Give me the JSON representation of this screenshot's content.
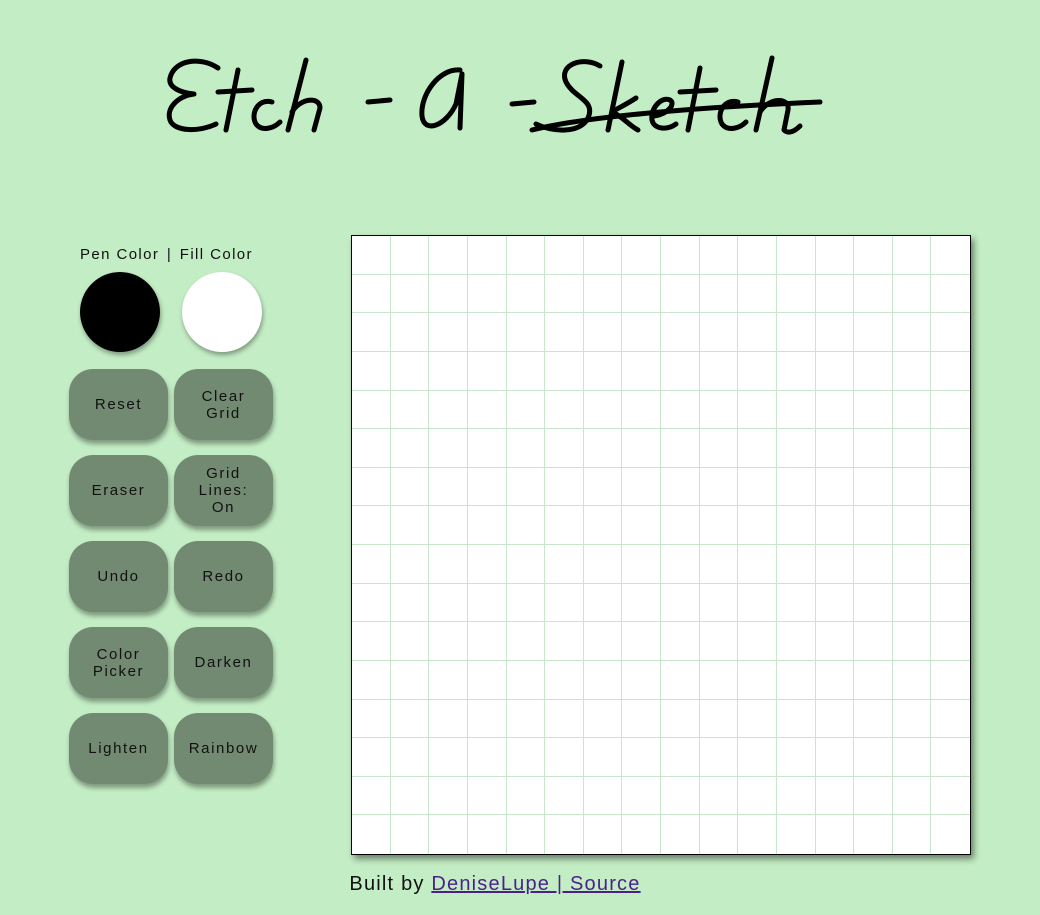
{
  "header": {
    "title": "Etch-A-Sketch"
  },
  "colors": {
    "background": "#c3edc4",
    "button": "#738a72",
    "grid_line": "#c8e6c9",
    "link": "#4b1f8c",
    "label_pen": "Pen Color",
    "label_separator": "|",
    "label_fill": "Fill Color",
    "pen_value": "#000000",
    "fill_value": "#ffffff"
  },
  "buttons": [
    {
      "name": "reset-button",
      "label": "Reset"
    },
    {
      "name": "clear-grid-button",
      "label": "Clear Grid"
    },
    {
      "name": "eraser-button",
      "label": "Eraser"
    },
    {
      "name": "grid-lines-button",
      "label": "Grid Lines: On"
    },
    {
      "name": "undo-button",
      "label": "Undo"
    },
    {
      "name": "redo-button",
      "label": "Redo"
    },
    {
      "name": "color-picker-button",
      "label": "Color Picker"
    },
    {
      "name": "darken-button",
      "label": "Darken"
    },
    {
      "name": "lighten-button",
      "label": "Lighten"
    },
    {
      "name": "rainbow-button",
      "label": "Rainbow"
    }
  ],
  "grid": {
    "size": 16
  },
  "footer": {
    "prefix": "Built by",
    "link_text": "DeniseLupe | Source"
  }
}
